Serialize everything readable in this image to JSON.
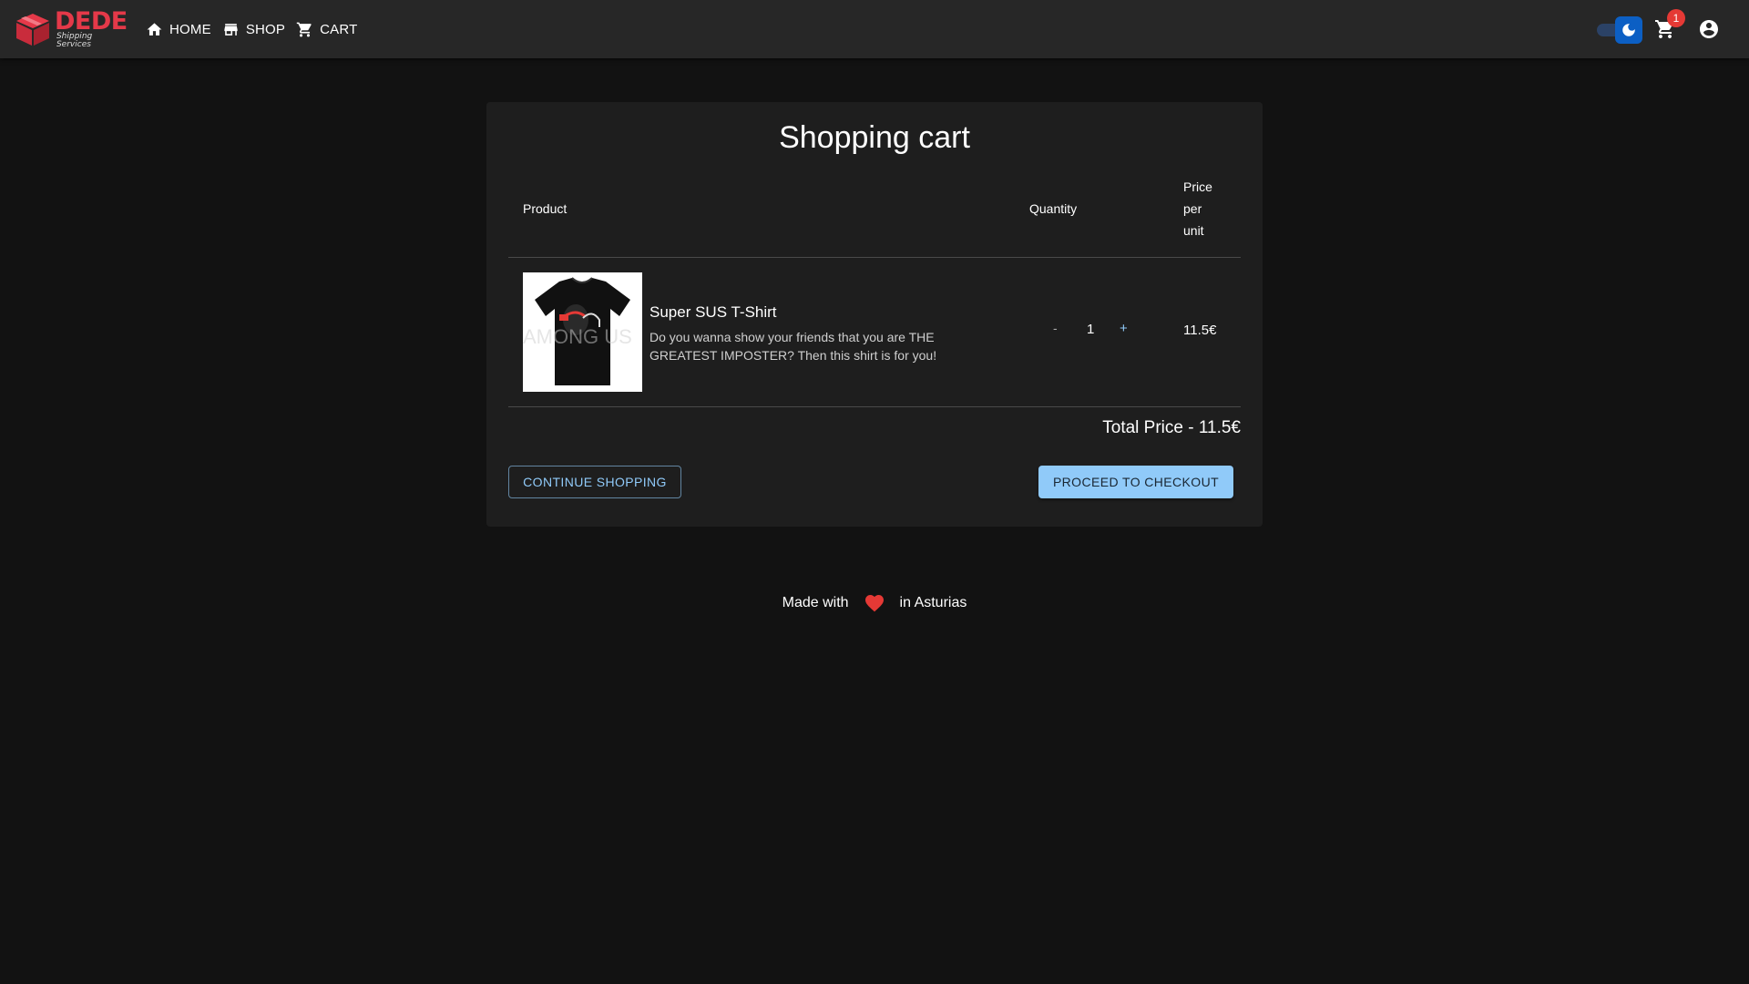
{
  "brand": {
    "name": "DEDE",
    "tagline": "Shipping Services",
    "accent_color": "#e53949"
  },
  "nav": {
    "items": [
      {
        "label": "HOME",
        "icon": "home-icon"
      },
      {
        "label": "SHOP",
        "icon": "store-icon"
      },
      {
        "label": "CART",
        "icon": "cart-icon"
      }
    ]
  },
  "toolbar": {
    "theme_toggle": {
      "state": "dark",
      "icon": "moon-icon"
    },
    "cart_badge": "1",
    "account_icon": "account-circle-icon"
  },
  "cart": {
    "title": "Shopping cart",
    "columns": {
      "product": "Product",
      "quantity": "Quantity",
      "price": "Price per unit"
    },
    "items": [
      {
        "name": "Super SUS T-Shirt",
        "description": "Do you wanna show your friends that you are THE GREATEST IMPOSTER? Then this shirt is for you!",
        "quantity": "1",
        "decrement_label": "-",
        "increment_label": "+",
        "unit_price": "11.5€"
      }
    ],
    "total_label": "Total Price - 11.5€",
    "continue_label": "CONTINUE SHOPPING",
    "checkout_label": "PROCEED TO CHECKOUT"
  },
  "footer": {
    "prefix": "Made with",
    "suffix": "in Asturias",
    "heart_icon": "heart-icon"
  },
  "colors": {
    "background": "#121212",
    "appbar": "#272727",
    "card": "#1e1e1e",
    "primary_light": "#90caf9",
    "badge_red": "#e53935"
  }
}
